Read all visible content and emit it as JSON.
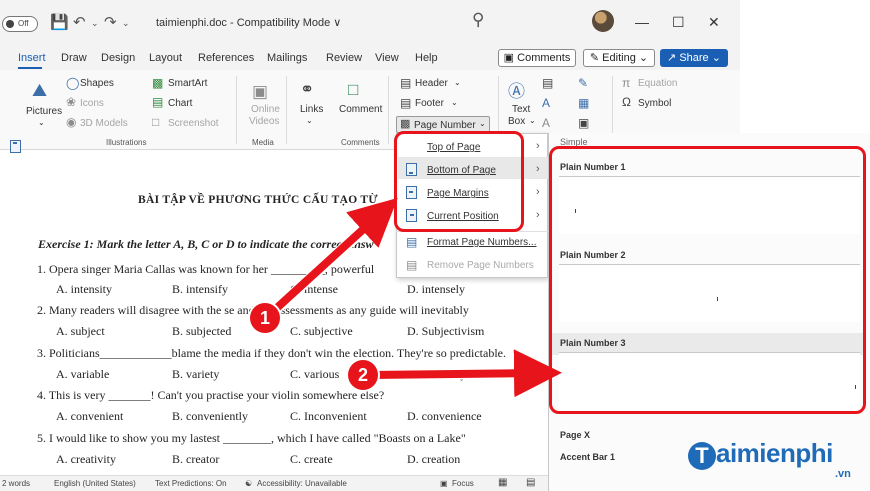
{
  "titlebar": {
    "autosave": "Off",
    "doc_title": "taimienphi.doc - Compatibility Mode ∨"
  },
  "menu": {
    "tabs": [
      "Insert",
      "Draw",
      "Design",
      "Layout",
      "References",
      "Mailings",
      "Review",
      "View",
      "Help"
    ],
    "comments": "Comments",
    "editing": "Editing",
    "share": "Share"
  },
  "ribbon": {
    "pictures": "Pictures",
    "shapes": "Shapes",
    "icons": "Icons",
    "models_3d": "3D Models",
    "smartart": "SmartArt",
    "chart": "Chart",
    "screenshot": "Screenshot",
    "online_videos_1": "Online",
    "online_videos_2": "Videos",
    "links": "Links",
    "comment": "Comment",
    "header": "Header",
    "footer": "Footer",
    "page_number": "Page Number",
    "text_box_1": "Text",
    "text_box_2": "Box",
    "equation": "Equation",
    "symbol": "Symbol",
    "group_illustrations": "Illustrations",
    "group_media": "Media",
    "group_comments": "Comments"
  },
  "page_number_menu": {
    "items": [
      "Top of Page",
      "Bottom of Page",
      "Page Margins",
      "Current Position",
      "Format Page Numbers...",
      "Remove Page Numbers"
    ]
  },
  "gallery": {
    "section": "Simple",
    "items": [
      "Plain Number 1",
      "Plain Number 2",
      "Plain Number 3",
      "Page X",
      "Accent Bar 1"
    ]
  },
  "document": {
    "heading": "BÀI TẬP VỀ PHƯƠNG THỨC CẤU TẠO TỪ",
    "exercise": "Exercise 1: Mark the letter A, B, C or D to indicate the correct answ",
    "q1": "1.   Opera singer Maria Callas was known for her _________, powerful",
    "q1_opts": [
      "A. intensity",
      "B. intensify",
      "C. intense",
      "D. intensely"
    ],
    "q2": "2. Many readers will disagree with the se        and the assessments as any guide will inevitably",
    "q2_opts": [
      "A. subject",
      "B. subjected",
      "C. subjective",
      "D. Subjectivism"
    ],
    "q3": "3. Politicians____________blame the media if they don't win the election. They're so predictable.",
    "q3_opts": [
      "A. variable",
      "B. variety",
      "C. various",
      "D. variously"
    ],
    "q4": "4. This is very _______! Can't you practise your violin somewhere else?",
    "q4_opts": [
      "A. convenient",
      "B. conveniently",
      "C. Inconvenient",
      "D. convenience"
    ],
    "q5": "5. I would like to show you my lastest ________, which I have called \"Boasts on a Lake\"",
    "q5_opts": [
      "A. creativity",
      "B. creator",
      "C. create",
      "D. creation"
    ]
  },
  "statusbar": {
    "words": "2 words",
    "language": "English (United States)",
    "predictions": "Text Predictions: On",
    "accessibility": "Accessibility: Unavailable",
    "focus": "Focus"
  },
  "annotations": {
    "badge1": "1",
    "badge2": "2"
  },
  "logo": {
    "text": "aimienphi",
    "letter": "T",
    "suffix": ".vn"
  },
  "colors": {
    "accent": "#1a5fb4",
    "annotation_red": "#e8141b",
    "logo_blue": "#1f6bb8"
  }
}
